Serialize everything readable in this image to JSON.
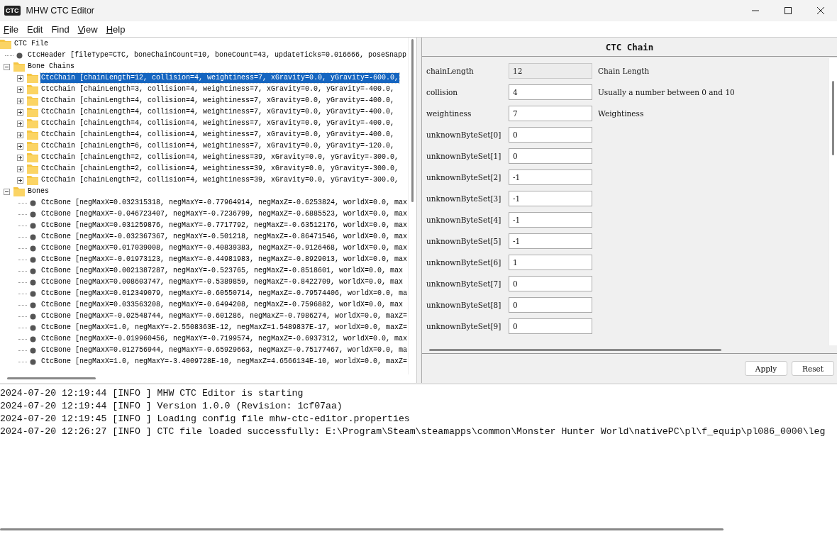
{
  "window": {
    "title": "MHW CTC Editor",
    "icon_text": "CTC"
  },
  "menu": [
    {
      "label": "File",
      "underline_first": true
    },
    {
      "label": "Edit",
      "underline_first": false
    },
    {
      "label": "Find",
      "underline_first": false
    },
    {
      "label": "View",
      "underline_first": true
    },
    {
      "label": "Help",
      "underline_first": true
    }
  ],
  "tree": {
    "label": "CTC File",
    "kind": "folder",
    "selected": false,
    "children": [
      {
        "label": "CtcHeader [fileType=CTC, boneChainCount=10, boneCount=43, updateTicks=0.016666, poseSnapp",
        "kind": "leaf",
        "selected": false
      },
      {
        "label": "Bone Chains",
        "kind": "folder",
        "expanded": true,
        "selected": false,
        "children": [
          {
            "label": "CtcChain [chainLength=12, collision=4, weightiness=7, xGravity=0.0, yGravity=-600.0,",
            "kind": "folder",
            "expanded": false,
            "selected": true
          },
          {
            "label": "CtcChain [chainLength=3, collision=4, weightiness=7, xGravity=0.0, yGravity=-400.0,",
            "kind": "folder",
            "expanded": false,
            "selected": false
          },
          {
            "label": "CtcChain [chainLength=4, collision=4, weightiness=7, xGravity=0.0, yGravity=-400.0,",
            "kind": "folder",
            "expanded": false,
            "selected": false
          },
          {
            "label": "CtcChain [chainLength=4, collision=4, weightiness=7, xGravity=0.0, yGravity=-400.0,",
            "kind": "folder",
            "expanded": false,
            "selected": false
          },
          {
            "label": "CtcChain [chainLength=4, collision=4, weightiness=7, xGravity=0.0, yGravity=-400.0,",
            "kind": "folder",
            "expanded": false,
            "selected": false
          },
          {
            "label": "CtcChain [chainLength=4, collision=4, weightiness=7, xGravity=0.0, yGravity=-400.0,",
            "kind": "folder",
            "expanded": false,
            "selected": false
          },
          {
            "label": "CtcChain [chainLength=6, collision=4, weightiness=7, xGravity=0.0, yGravity=-120.0,",
            "kind": "folder",
            "expanded": false,
            "selected": false
          },
          {
            "label": "CtcChain [chainLength=2, collision=4, weightiness=39, xGravity=0.0, yGravity=-300.0,",
            "kind": "folder",
            "expanded": false,
            "selected": false
          },
          {
            "label": "CtcChain [chainLength=2, collision=4, weightiness=39, xGravity=0.0, yGravity=-300.0,",
            "kind": "folder",
            "expanded": false,
            "selected": false
          },
          {
            "label": "CtcChain [chainLength=2, collision=4, weightiness=39, xGravity=0.0, yGravity=-300.0,",
            "kind": "folder",
            "expanded": false,
            "selected": false
          }
        ]
      },
      {
        "label": "Bones",
        "kind": "folder",
        "expanded": true,
        "selected": false,
        "children": [
          {
            "label": "CtcBone [negMaxX=0.032315318, negMaxY=-0.77964914, negMaxZ=-0.6253824, worldX=0.0, max",
            "kind": "leaf",
            "selected": false
          },
          {
            "label": "CtcBone [negMaxX=-0.046723407, negMaxY=-0.7236799, negMaxZ=-0.6885523, worldX=0.0, max",
            "kind": "leaf",
            "selected": false
          },
          {
            "label": "CtcBone [negMaxX=0.031259876, negMaxY=-0.7717792, negMaxZ=-0.63512176, worldX=0.0, max",
            "kind": "leaf",
            "selected": false
          },
          {
            "label": "CtcBone [negMaxX=-0.032367367, negMaxY=-0.501218, negMaxZ=-0.86471546, worldX=0.0, max",
            "kind": "leaf",
            "selected": false
          },
          {
            "label": "CtcBone [negMaxX=0.017039008, negMaxY=-0.40839383, negMaxZ=-0.9126468, worldX=0.0, max",
            "kind": "leaf",
            "selected": false
          },
          {
            "label": "CtcBone [negMaxX=-0.01973123, negMaxY=-0.44981983, negMaxZ=-0.8929013, worldX=0.0, max",
            "kind": "leaf",
            "selected": false
          },
          {
            "label": "CtcBone [negMaxX=0.0021387287, negMaxY=-0.523765, negMaxZ=-0.8518601, worldX=0.0, max",
            "kind": "leaf",
            "selected": false
          },
          {
            "label": "CtcBone [negMaxX=0.008603747, negMaxY=-0.5389859, negMaxZ=-0.8422709, worldX=0.0, max",
            "kind": "leaf",
            "selected": false
          },
          {
            "label": "CtcBone [negMaxX=0.012349079, negMaxY=-0.60550714, negMaxZ=-0.79574406, worldX=0.0, ma",
            "kind": "leaf",
            "selected": false
          },
          {
            "label": "CtcBone [negMaxX=0.033563208, negMaxY=-0.6494208, negMaxZ=-0.7596882, worldX=0.0, max",
            "kind": "leaf",
            "selected": false
          },
          {
            "label": "CtcBone [negMaxX=-0.02548744, negMaxY=-0.601286, negMaxZ=-0.7986274, worldX=0.0, maxZ=",
            "kind": "leaf",
            "selected": false
          },
          {
            "label": "CtcBone [negMaxX=1.0, negMaxY=-2.5508363E-12, negMaxZ=1.5489837E-17, worldX=0.0, maxZ=",
            "kind": "leaf",
            "selected": false
          },
          {
            "label": "CtcBone [negMaxX=-0.019960456, negMaxY=-0.7199574, negMaxZ=-0.6937312, worldX=0.0, max",
            "kind": "leaf",
            "selected": false
          },
          {
            "label": "CtcBone [negMaxX=0.012756944, negMaxY=-0.65929663, negMaxZ=-0.75177467, worldX=0.0, ma",
            "kind": "leaf",
            "selected": false
          },
          {
            "label": "CtcBone [negMaxX=1.0, negMaxY=-3.4009728E-10, negMaxZ=4.6566134E-10, worldX=0.0, maxZ=",
            "kind": "leaf",
            "selected": false
          }
        ]
      }
    ]
  },
  "details": {
    "title": "CTC Chain",
    "fields": [
      {
        "label": "chainLength",
        "value": "12",
        "disabled": true,
        "description": "Chain Length"
      },
      {
        "label": "collision",
        "value": "4",
        "disabled": false,
        "description": "Usually a number between 0 and 10"
      },
      {
        "label": "weightiness",
        "value": "7",
        "disabled": false,
        "description": "Weightiness"
      },
      {
        "label": "unknownByteSet[0]",
        "value": "0",
        "disabled": false
      },
      {
        "label": "unknownByteSet[1]",
        "value": "0",
        "disabled": false
      },
      {
        "label": "unknownByteSet[2]",
        "value": "-1",
        "disabled": false
      },
      {
        "label": "unknownByteSet[3]",
        "value": "-1",
        "disabled": false
      },
      {
        "label": "unknownByteSet[4]",
        "value": "-1",
        "disabled": false
      },
      {
        "label": "unknownByteSet[5]",
        "value": "-1",
        "disabled": false
      },
      {
        "label": "unknownByteSet[6]",
        "value": "1",
        "disabled": false
      },
      {
        "label": "unknownByteSet[7]",
        "value": "0",
        "disabled": false
      },
      {
        "label": "unknownByteSet[8]",
        "value": "0",
        "disabled": false
      },
      {
        "label": "unknownByteSet[9]",
        "value": "0",
        "disabled": false
      }
    ],
    "buttons": [
      "Apply",
      "Reset"
    ]
  },
  "log": [
    "2024-07-20 12:19:44 [INFO ] MHW CTC Editor is starting",
    "2024-07-20 12:19:44 [INFO ] Version 1.0.0 (Revision: 1cf07aa)",
    "2024-07-20 12:19:45 [INFO ] Loading config file mhw-ctc-editor.properties",
    "2024-07-20 12:26:27 [INFO ] CTC file loaded successfully: E:\\Program\\Steam\\steamapps\\common\\Monster Hunter World\\nativePC\\pl\\f_equip\\pl086_0000\\leg"
  ]
}
